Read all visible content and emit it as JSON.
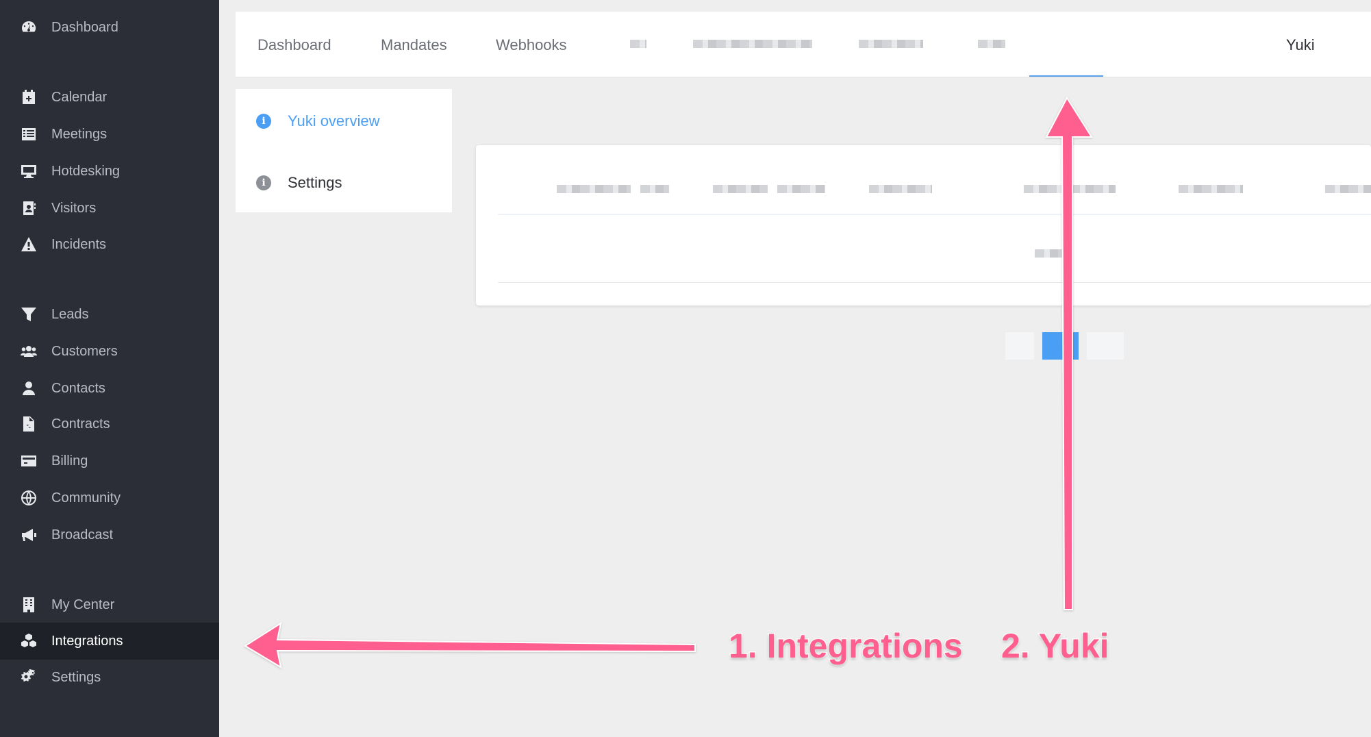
{
  "sidebar": {
    "items": [
      {
        "label": "Dashboard",
        "icon": "dashboard-gauge-icon"
      },
      {
        "label": "Calendar",
        "icon": "calendar-plus-icon"
      },
      {
        "label": "Meetings",
        "icon": "list-icon"
      },
      {
        "label": "Hotdesking",
        "icon": "desktop-icon"
      },
      {
        "label": "Visitors",
        "icon": "address-book-icon"
      },
      {
        "label": "Incidents",
        "icon": "warning-icon"
      },
      {
        "label": "Leads",
        "icon": "funnel-icon"
      },
      {
        "label": "Customers",
        "icon": "users-icon"
      },
      {
        "label": "Contacts",
        "icon": "user-icon"
      },
      {
        "label": "Contracts",
        "icon": "file-pdf-icon"
      },
      {
        "label": "Billing",
        "icon": "credit-card-icon"
      },
      {
        "label": "Community",
        "icon": "globe-icon"
      },
      {
        "label": "Broadcast",
        "icon": "megaphone-icon"
      },
      {
        "label": "My Center",
        "icon": "building-icon"
      },
      {
        "label": "Integrations",
        "icon": "cubes-icon",
        "active": true
      },
      {
        "label": "Settings",
        "icon": "cogs-icon"
      }
    ]
  },
  "tabs": [
    {
      "label": "Dashboard"
    },
    {
      "label": "Mandates"
    },
    {
      "label": "Webhooks"
    },
    {
      "label": "Yuki",
      "active": true
    }
  ],
  "submenu": [
    {
      "label": "Yuki overview",
      "active": true
    },
    {
      "label": "Settings"
    }
  ],
  "annotations": {
    "step1": "1. Integrations",
    "step2": "2. Yuki"
  },
  "colors": {
    "sidebar_bg": "#2b2e37",
    "accent": "#4a9ff5",
    "annotation": "#ff5f8f"
  }
}
